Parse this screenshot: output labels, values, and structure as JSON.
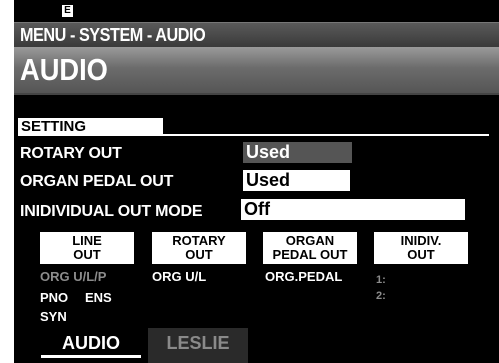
{
  "status": {
    "icon_letter": "E"
  },
  "breadcrumb": "MENU - SYSTEM - AUDIO",
  "title": "AUDIO",
  "section_header": "SETTING",
  "rows": [
    {
      "label": "ROTARY OUT",
      "value": "Used"
    },
    {
      "label": "ORGAN PEDAL OUT",
      "value": "Used"
    },
    {
      "label": "INIDIVIDUAL OUT MODE",
      "value": "Off"
    }
  ],
  "outputs": [
    {
      "line1": "LINE",
      "line2": "OUT"
    },
    {
      "line1": "ROTARY",
      "line2": "OUT"
    },
    {
      "line1": "ORGAN",
      "line2": "PEDAL OUT"
    },
    {
      "line1": "INIDIV.",
      "line2": "OUT"
    }
  ],
  "assignments": {
    "line_out_dim": "ORG U/L/P",
    "line_out_a": "PNO",
    "line_out_b": "ENS",
    "line_out_c": "SYN",
    "rotary_out": "ORG U/L",
    "organ_pedal_out": "ORG.PEDAL",
    "indiv_1": "1:",
    "indiv_2": "2:"
  },
  "tabs": [
    {
      "label": "AUDIO",
      "active": true
    },
    {
      "label": "LESLIE",
      "active": false
    }
  ]
}
